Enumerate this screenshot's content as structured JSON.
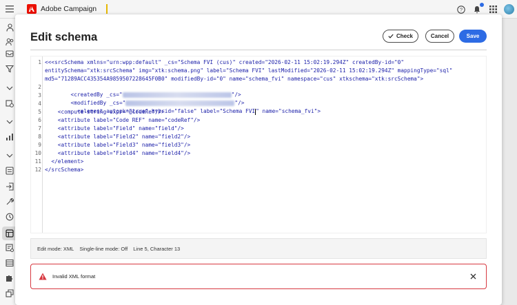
{
  "topbar": {
    "app_name": "Adobe Campaign",
    "icons": [
      "menu-icon",
      "adobe-logo-icon",
      "help-icon",
      "notification-bell-icon",
      "apps-grid-icon",
      "avatar"
    ],
    "accent_color": "#e6b800"
  },
  "leftnav": {
    "icons": [
      "user-icon",
      "people-icon",
      "inbox-icon",
      "filter-icon",
      "chevron-down-icon",
      "settings-icon",
      "chevron-down-icon",
      "chart-icon",
      "chevron-down-icon",
      "list-icon",
      "exit-icon",
      "tools-icon",
      "history-icon",
      "schema-icon",
      "settings-list-icon",
      "table-icon",
      "puzzle-icon",
      "layers-icon"
    ],
    "active_icon": "schema-icon"
  },
  "dialog": {
    "title": "Edit schema",
    "check_label": "Check",
    "cancel_label": "Cancel",
    "save_label": "Save",
    "primary_color": "#2d6be4"
  },
  "editor": {
    "line_numbers": [
      "1",
      "2",
      "3",
      "4",
      "5",
      "6",
      "7",
      "8",
      "9",
      "10",
      "11",
      "12"
    ],
    "lines": {
      "l1a": "<<<srcSchema xmlns=\"urn:wpp:default\" _cs=\"Schema FVI (cus)\" created=\"2026-02-11 15:02:19.294Z\" createdBy-id=\"0\"",
      "l1b": "entitySchema=\"xtk:srcSchema\" img=\"xtk:schema.png\" label=\"Schema FVI\" lastModified=\"2026-02-11 15:02:19.294Z\" mappingType=\"sql\"",
      "l1c": "md5=\"71289ACC435354A9859507228645F0B0\" modifiedBy-id=\"0\" name=\"schema_fvi\" namespace=\"cus\" xtkschema=\"xtk:srcSchema\">",
      "l2_pre": "  <createdBy _cs=\"",
      "l2_post": "\"/>",
      "l3_pre": "  <modifiedBy _cs=\"",
      "l3_post": "\"/>",
      "l4_pre": "    <element autopk=\"true\" hybrid=\"false\" label=\"Schema FVI",
      "l4_post": "\" name=\"schema_fvi\">",
      "l5": "    <compute-string expr=\"@codeRef\"/>",
      "l6": "    <attribute label=\"Code REF\" name=\"codeRef\"/>",
      "l7": "    <attribute label=\"Field\" name=\"field\"/>",
      "l8": "    <attribute label=\"Field2\" name=\"field2\"/>",
      "l9": "    <attribute label=\"Field3\" name=\"field3\"/>",
      "l10": "    <attribute label=\"Field4\" name=\"field4\"/>",
      "l11": "  </element>",
      "l12": "</srcSchema>"
    }
  },
  "status": {
    "edit_mode": "Edit mode: XML",
    "single_line": "Single-line mode: Off",
    "position": "Line 5, Character 13"
  },
  "error": {
    "message": "Invalid XML format",
    "color": "#d7373f"
  }
}
